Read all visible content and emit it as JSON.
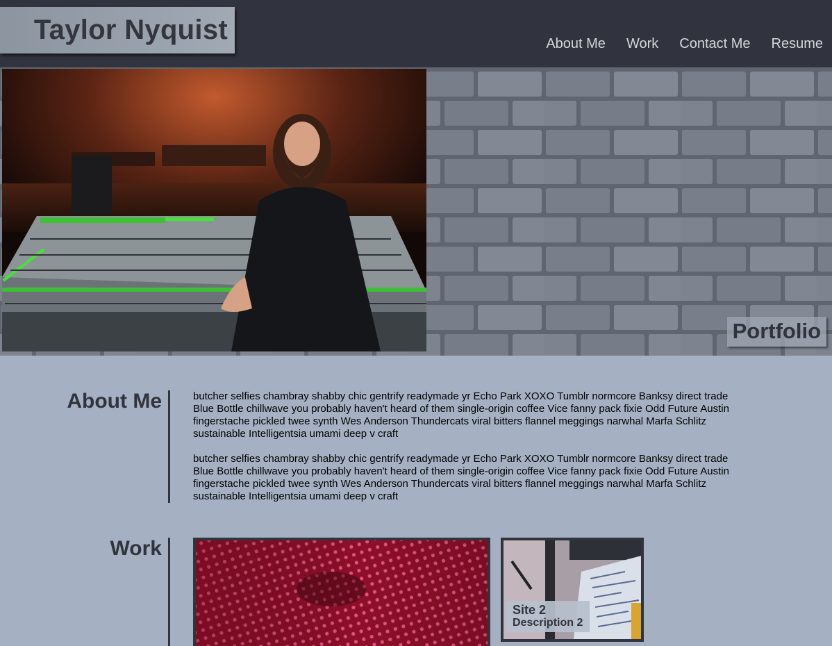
{
  "header": {
    "brand": "Taylor Nyquist",
    "nav": [
      "About Me",
      "Work",
      "Contact Me",
      "Resume"
    ]
  },
  "hero": {
    "badge": "Portfolio"
  },
  "about": {
    "title": "About Me",
    "paragraphs": [
      "butcher selfies chambray shabby chic gentrify readymade yr Echo Park XOXO Tumblr normcore Banksy direct trade Blue Bottle chillwave you probably haven't heard of them single-origin coffee Vice fanny pack fixie Odd Future Austin fingerstache pickled twee synth Wes Anderson Thundercats viral bitters flannel meggings narwhal Marfa Schlitz sustainable Intelligentsia umami deep v craft",
      "butcher selfies chambray shabby chic gentrify readymade yr Echo Park XOXO Tumblr normcore Banksy direct trade Blue Bottle chillwave you probably haven't heard of them single-origin coffee Vice fanny pack fixie Odd Future Austin fingerstache pickled twee synth Wes Anderson Thundercats viral bitters flannel meggings narwhal Marfa Schlitz sustainable Intelligentsia umami deep v craft"
    ]
  },
  "work": {
    "title": "Work",
    "cards": [
      {
        "title": "",
        "description": ""
      },
      {
        "title": "Site 2",
        "description": "Description 2"
      }
    ]
  },
  "colors": {
    "header_bg": "#31343e",
    "page_bg": "#a5b1c2",
    "accent_dark": "#31343d"
  }
}
